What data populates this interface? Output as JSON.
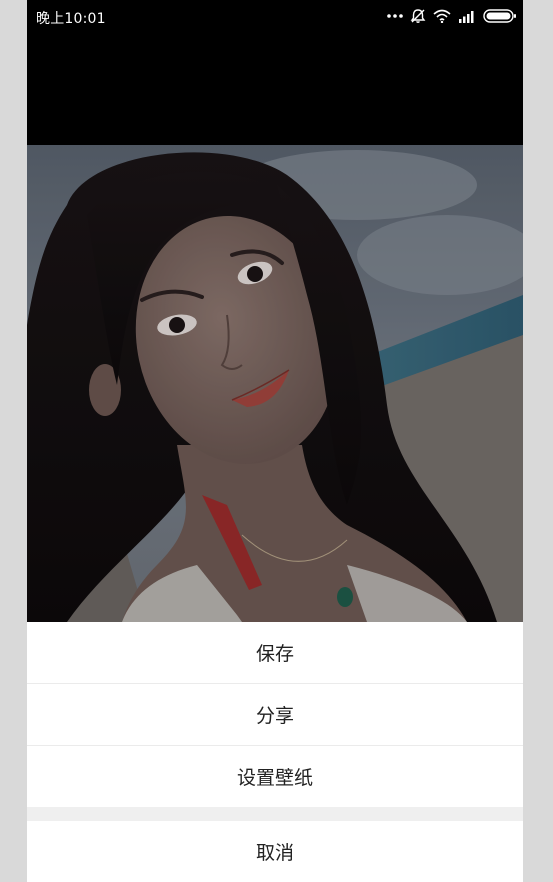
{
  "status_bar": {
    "time": "晚上10:01",
    "icons": [
      "more-dots-icon",
      "alarm-off-icon",
      "wifi-icon",
      "signal-icon",
      "battery-icon"
    ]
  },
  "photo": {
    "subject": "selfie-photo",
    "overlay_color": "#000000"
  },
  "action_sheet": {
    "items": [
      {
        "label": "保存"
      },
      {
        "label": "分享"
      },
      {
        "label": "设置壁纸"
      }
    ],
    "cancel_label": "取消"
  },
  "colors": {
    "sheet_background": "#ffffff",
    "sheet_gap": "#efefef",
    "text": "#222222",
    "frame": "#d9d9d9"
  }
}
